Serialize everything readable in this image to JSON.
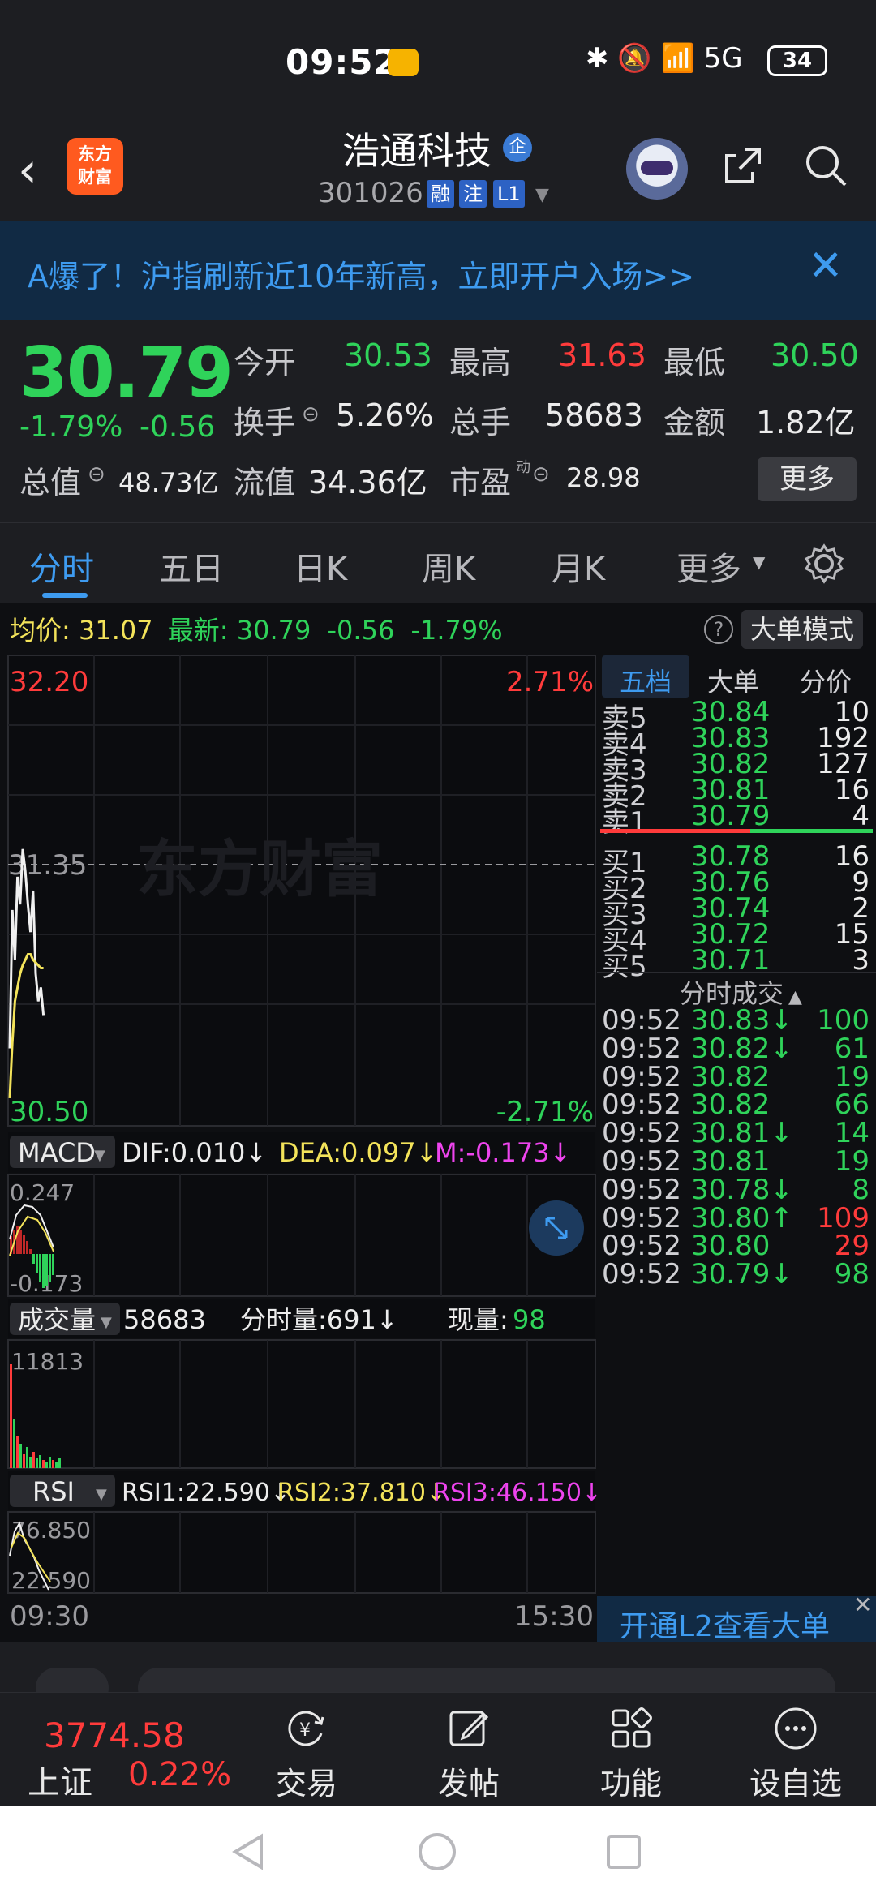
{
  "status_bar": {
    "time": "09:52",
    "icons": "✱ 🔕 📶 5G",
    "battery": "34"
  },
  "header": {
    "logo_text_1": "东方",
    "logo_text_2": "财富",
    "stock_name": "浩通科技",
    "qi_badge": "企",
    "stock_code": "301026",
    "tag1": "融",
    "tag2": "注",
    "tag3": "L1"
  },
  "banner": {
    "text": "A爆了！沪指刷新近10年新高，立即开户入场>>",
    "close": "✕"
  },
  "quote": {
    "price": "30.79",
    "chg_pct": "-1.79%",
    "chg_amt": "-0.56",
    "labels": {
      "open": "今开",
      "high": "最高",
      "low": "最低",
      "turnover": "换手",
      "volume": "总手",
      "amount": "金额",
      "mcap": "总值",
      "float_mcap": "流值",
      "pe": "市盈"
    },
    "open": "30.53",
    "high": "31.63",
    "low": "30.50",
    "turnover": "5.26%",
    "volume": "58683",
    "amount": "1.82亿",
    "mcap": "48.73亿",
    "float_mcap": "34.36亿",
    "pe_sup": "动",
    "pe": "28.98",
    "more": "更多"
  },
  "tabs": [
    "分时",
    "五日",
    "日K",
    "周K",
    "月K",
    "更多"
  ],
  "intraday": {
    "avg_label": "均价:",
    "avg": "31.07",
    "latest_label": "最新:",
    "latest": "30.79",
    "chg_amt": "-0.56",
    "chg_pct": "-1.79%",
    "help": "?",
    "big_order_mode": "大单模式",
    "y_top": "32.20",
    "y_mid": "31.35",
    "y_bot": "30.50",
    "pct_top": "2.71%",
    "pct_bot": "-2.71%",
    "watermark": "东方财富",
    "time_start": "09:30",
    "time_end": "15:30"
  },
  "macd": {
    "label": "MACD",
    "dif": "DIF:0.010↓",
    "dea": "DEA:0.097↓",
    "m": "M:-0.173↓",
    "top": "0.247",
    "bot": "-0.173"
  },
  "volume": {
    "label": "成交量",
    "total": "58683",
    "min_vol": "分时量:691↓",
    "now_label": "现量:",
    "now": "98",
    "max": "11813"
  },
  "rsi": {
    "label": "RSI",
    "rsi1": "RSI1:22.590↓",
    "rsi2": "RSI2:37.810↓",
    "rsi3": "RSI3:46.150↓",
    "top": "76.850",
    "bot": "22.590"
  },
  "orderbook": {
    "tabs": [
      "五档",
      "大单",
      "分价"
    ],
    "asks": [
      {
        "label": "卖5",
        "price": "30.84",
        "vol": "10"
      },
      {
        "label": "卖4",
        "price": "30.83",
        "vol": "192"
      },
      {
        "label": "卖3",
        "price": "30.82",
        "vol": "127"
      },
      {
        "label": "卖2",
        "price": "30.81",
        "vol": "16"
      },
      {
        "label": "卖1",
        "price": "30.79",
        "vol": "4"
      }
    ],
    "bids": [
      {
        "label": "买1",
        "price": "30.78",
        "vol": "16"
      },
      {
        "label": "买2",
        "price": "30.76",
        "vol": "9"
      },
      {
        "label": "买3",
        "price": "30.74",
        "vol": "2"
      },
      {
        "label": "买4",
        "price": "30.72",
        "vol": "15"
      },
      {
        "label": "买5",
        "price": "30.71",
        "vol": "3"
      }
    ],
    "ticks_title": "分时成交",
    "ticks": [
      {
        "time": "09:52",
        "price": "30.83↓",
        "vol": "100",
        "vcolor": "g"
      },
      {
        "time": "09:52",
        "price": "30.82↓",
        "vol": "61",
        "vcolor": "g"
      },
      {
        "time": "09:52",
        "price": "30.82",
        "vol": "19",
        "vcolor": "g"
      },
      {
        "time": "09:52",
        "price": "30.82",
        "vol": "66",
        "vcolor": "g"
      },
      {
        "time": "09:52",
        "price": "30.81↓",
        "vol": "14",
        "vcolor": "g"
      },
      {
        "time": "09:52",
        "price": "30.81",
        "vol": "19",
        "vcolor": "g"
      },
      {
        "time": "09:52",
        "price": "30.78↓",
        "vol": "8",
        "vcolor": "g"
      },
      {
        "time": "09:52",
        "price": "30.80↑",
        "vol": "109",
        "vcolor": "r"
      },
      {
        "time": "09:52",
        "price": "30.80",
        "vol": "29",
        "vcolor": "r"
      },
      {
        "time": "09:52",
        "price": "30.79↓",
        "vol": "98",
        "vcolor": "g"
      }
    ],
    "l2_button": "开通L2查看大单"
  },
  "bottom_nav": {
    "index_value": "3774.58",
    "index_name": "上证",
    "index_pct": "0.22%",
    "items": [
      "交易",
      "发帖",
      "功能",
      "设自选"
    ]
  },
  "chart_data": [
    {
      "type": "line",
      "title": "分时",
      "series": [
        {
          "name": "最新",
          "values": [
            30.78,
            31.28,
            31.1,
            31.4,
            31.3,
            31.5,
            31.42,
            31.3,
            31.2,
            31.35,
            31.05,
            30.95,
            31.0,
            30.9
          ]
        },
        {
          "name": "均价",
          "values": [
            30.6,
            30.8,
            30.95,
            31.0,
            31.05,
            31.08,
            31.1,
            31.12,
            31.12,
            31.1,
            31.09,
            31.08,
            31.07,
            31.07
          ]
        }
      ],
      "ylim": [
        30.5,
        32.2
      ]
    }
  ]
}
